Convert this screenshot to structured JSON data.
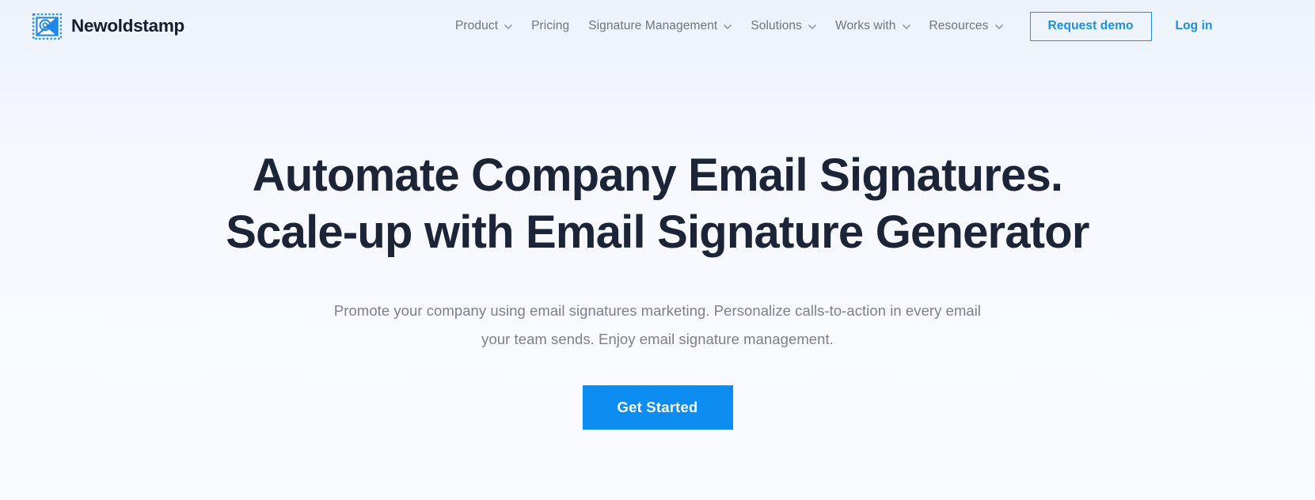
{
  "header": {
    "logo": {
      "icon": "stamp-envelope-at-icon",
      "wordmark": "Newoldstamp"
    },
    "nav_items": [
      {
        "label": "Product",
        "has_dropdown": true
      },
      {
        "label": "Pricing",
        "has_dropdown": false
      },
      {
        "label": "Signature Management",
        "has_dropdown": true
      },
      {
        "label": "Solutions",
        "has_dropdown": true
      },
      {
        "label": "Works with",
        "has_dropdown": true
      },
      {
        "label": "Resources",
        "has_dropdown": true
      }
    ],
    "request_demo_label": "Request demo",
    "login_label": "Log in"
  },
  "hero": {
    "title_line_1": "Automate Company Email Signatures.",
    "title_line_2": "Scale-up with Email Signature Generator",
    "subtitle_line_1": "Promote your company using email signatures marketing. Personalize calls-to-action in every email",
    "subtitle_line_2": "your team sends. Enjoy email signature management.",
    "cta_label": "Get Started"
  },
  "colors": {
    "brand_blue": "#1b95eb",
    "cta_blue": "#0d8cf2",
    "headline_navy": "#1c2438",
    "nav_text_grey": "#6f7580",
    "subtitle_grey": "#7a818c",
    "page_background": "#f7f9fe"
  }
}
